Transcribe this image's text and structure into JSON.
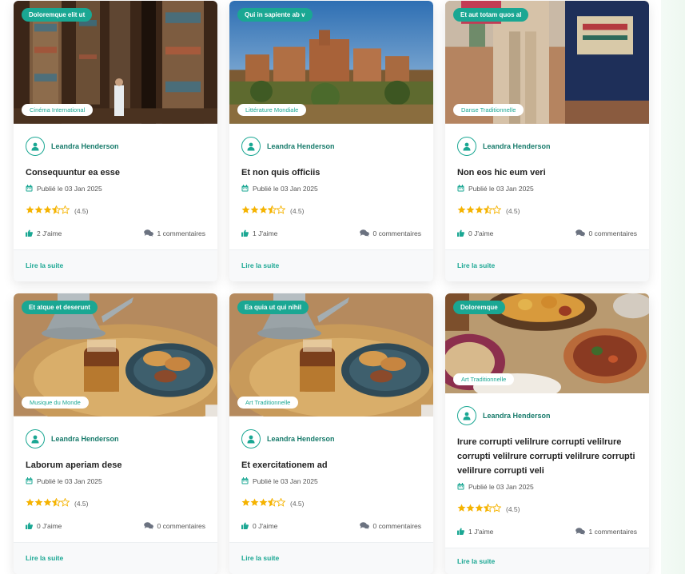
{
  "colors": {
    "accent": "#1aa793",
    "author": "#167a6a",
    "star": "#f5b301",
    "icon_grey": "#6b7280"
  },
  "cards": [
    {
      "top_badge": "Doloremque elit ut",
      "category": "Cinéma International",
      "author": "Leandra Henderson",
      "title": "Consequuntur ea esse",
      "date": "Publié le 03 Jan 2025",
      "rating": 3.5,
      "rating_text": "(4.5)",
      "likes": "2 J'aime",
      "comments": "1 commentaires",
      "read_more": "Lire la suite",
      "image_icon": "temple-columns-image"
    },
    {
      "top_badge": "Qui in sapiente ab v",
      "category": "Littérature Mondiale",
      "author": "Leandra Henderson",
      "title": "Et non quis officiis",
      "date": "Publié le 03 Jan 2025",
      "rating": 3.5,
      "rating_text": "(4.5)",
      "likes": "1 J'aime",
      "comments": "0 commentaires",
      "read_more": "Lire la suite",
      "image_icon": "kasbah-image"
    },
    {
      "top_badge": "Et aut totam quos al",
      "category": "Danse Traditionnelle",
      "author": "Leandra Henderson",
      "title": "Non eos hic eum veri",
      "date": "Publié le 03 Jan 2025",
      "rating": 3.5,
      "rating_text": "(4.5)",
      "likes": "0 J'aime",
      "comments": "0 commentaires",
      "read_more": "Lire la suite",
      "image_icon": "camel-image"
    },
    {
      "top_badge": "Et atque et deserunt",
      "category": "Musique du Monde",
      "author": "Leandra Henderson",
      "title": "Laborum aperiam dese",
      "date": "Publié le 03 Jan 2025",
      "rating": 3.5,
      "rating_text": "(4.5)",
      "likes": "0 J'aime",
      "comments": "0 commentaires",
      "read_more": "Lire la suite",
      "image_icon": "tea-tray-image"
    },
    {
      "top_badge": "Ea quia ut qui nihil",
      "category": "Art Traditionnelle",
      "author": "Leandra Henderson",
      "title": "Et exercitationem ad",
      "date": "Publié le 03 Jan 2025",
      "rating": 3.5,
      "rating_text": "(4.5)",
      "likes": "0 J'aime",
      "comments": "0 commentaires",
      "read_more": "Lire la suite",
      "image_icon": "tea-tray-image"
    },
    {
      "top_badge": "Doloremque",
      "category": "Art Traditionnelle",
      "author": "Leandra Henderson",
      "title": "Irure corrupti velilrure corrupti velilrure corrupti velilrure corrupti velilrure corrupti velilrure corrupti veli",
      "date": "Publié le 03 Jan 2025",
      "rating": 3.5,
      "rating_text": "(4.5)",
      "likes": "1 J'aime",
      "comments": "1 commentaires",
      "read_more": "Lire la suite",
      "image_icon": "tagine-food-image"
    }
  ]
}
